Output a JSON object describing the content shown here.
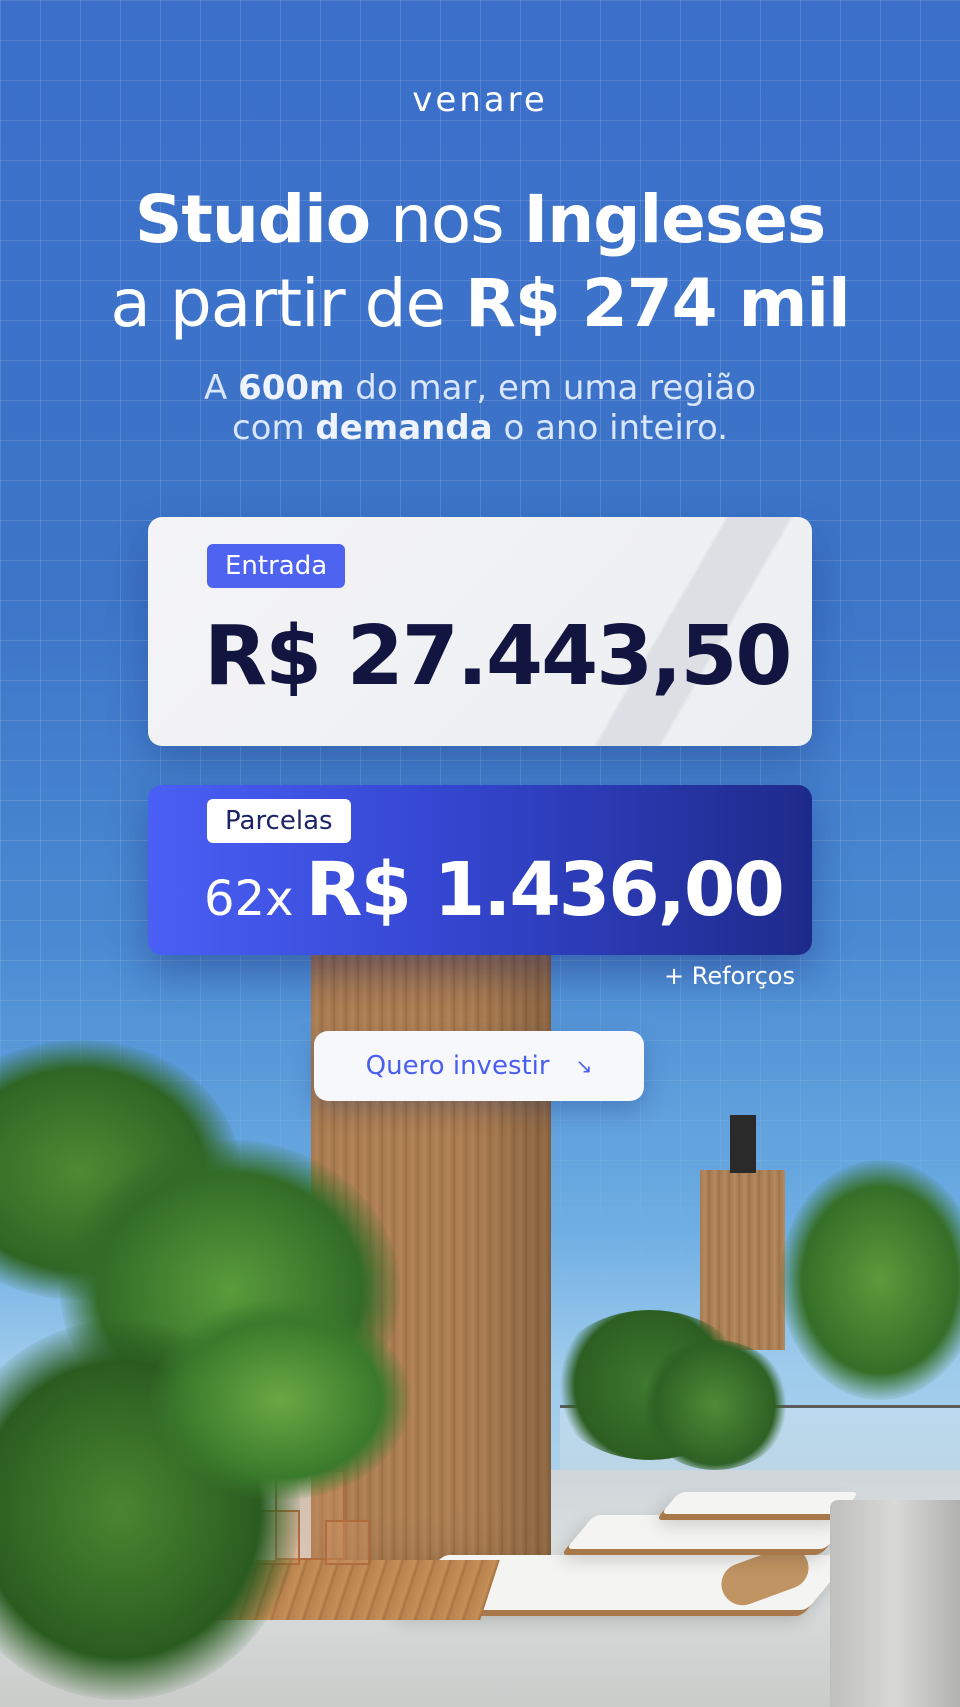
{
  "brand": {
    "logo_text": "venare"
  },
  "headline": {
    "line1_bold1": "Studio",
    "line1_regular": "nos",
    "line1_bold2": "Ingleses",
    "line2_regular": "a partir de",
    "line2_bold": "R$ 274 mil"
  },
  "subtitle": {
    "part1": "A",
    "bold1": "600m",
    "part2": "do mar, em uma região",
    "part3": "com",
    "bold2": "demanda",
    "part4": "o ano inteiro."
  },
  "entrada": {
    "label": "Entrada",
    "amount": "R$ 27.443,50"
  },
  "parcelas": {
    "label": "Parcelas",
    "multiplier": "62x",
    "amount": "R$ 1.436,00"
  },
  "reforcos": "+ Reforços",
  "cta": {
    "label": "Quero investir",
    "icon": "arrow-down-right-icon"
  },
  "colors": {
    "background_blue": "#3d75c8",
    "accent_blue": "#4e63f0",
    "dark_navy": "#11153f"
  }
}
